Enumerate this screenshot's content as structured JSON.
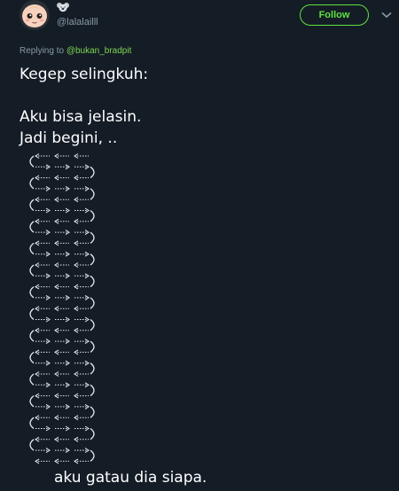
{
  "header": {
    "handle": "@lalalailll",
    "follow_label": "Follow",
    "avatar_icon": "cartoon-baby-avatar",
    "badge_icon": "koala-icon",
    "more_icon": "chevron-down-icon"
  },
  "reply": {
    "prefix": "Replying to",
    "mention": "@bukan_bradpit"
  },
  "tweet": {
    "lines": [
      "Kegep selingkuh:",
      "",
      "Aku bisa jelasin.",
      "Jadi begini, .."
    ],
    "ending": "aku gatau dia siapa."
  },
  "colors": {
    "background": "#141d26",
    "accent": "#5fe140",
    "muted": "#8899a6",
    "text": "#ffffff"
  }
}
